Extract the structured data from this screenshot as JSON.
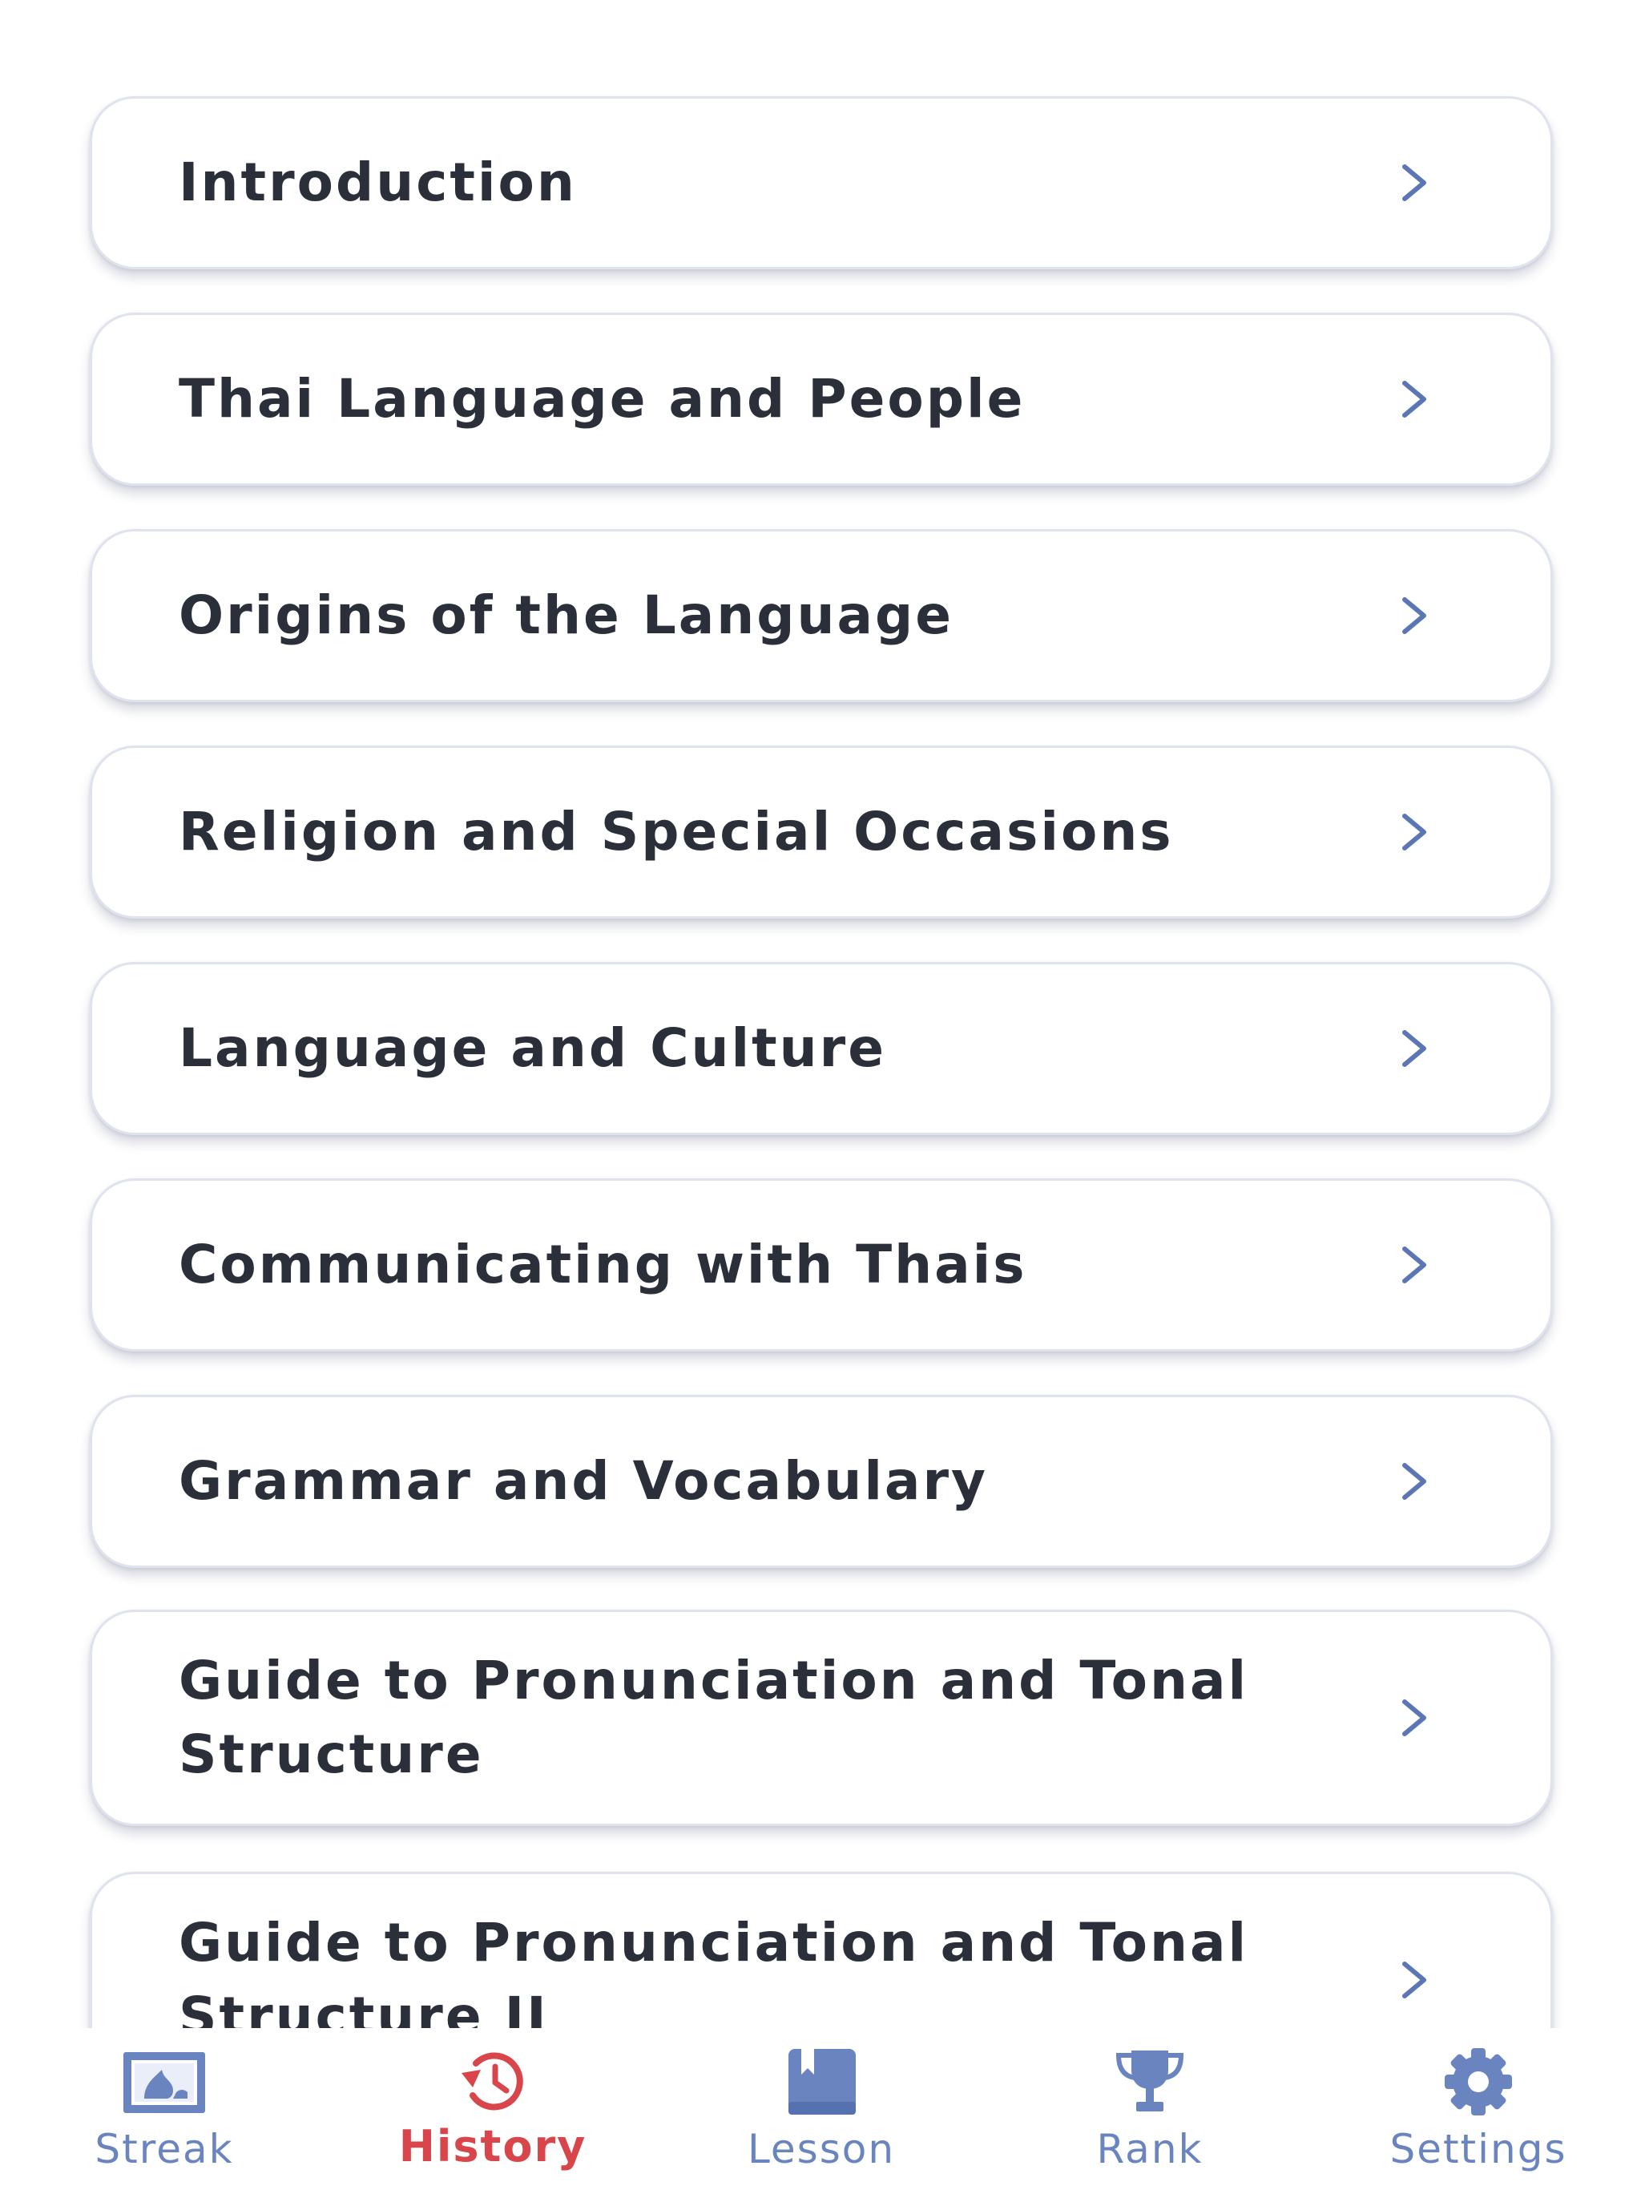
{
  "lessons": [
    {
      "title": "Introduction"
    },
    {
      "title": "Thai Language and People"
    },
    {
      "title": "Origins of the Language"
    },
    {
      "title": "Religion and Special Occasions"
    },
    {
      "title": "Language and Culture"
    },
    {
      "title": "Communicating with Thais"
    },
    {
      "title": "Grammar and Vocabulary"
    },
    {
      "title": "Guide to Pronunciation and Tonal Structure"
    },
    {
      "title": "Guide to Pronunciation and Tonal Structure II"
    }
  ],
  "tabbar": {
    "active": "History",
    "tabs": [
      {
        "label": "Streak",
        "icon": "streak-image-icon"
      },
      {
        "label": "History",
        "icon": "history-clock-icon"
      },
      {
        "label": "Lesson",
        "icon": "book-icon"
      },
      {
        "label": "Rank",
        "icon": "trophy-icon"
      },
      {
        "label": "Settings",
        "icon": "gear-icon"
      }
    ]
  },
  "colors": {
    "accent_active": "#d8454a",
    "tab_inactive": "#6a84bf",
    "chevron": "#5b76b4",
    "card_border": "#dfe3ee",
    "text": "#2b2f3a"
  }
}
